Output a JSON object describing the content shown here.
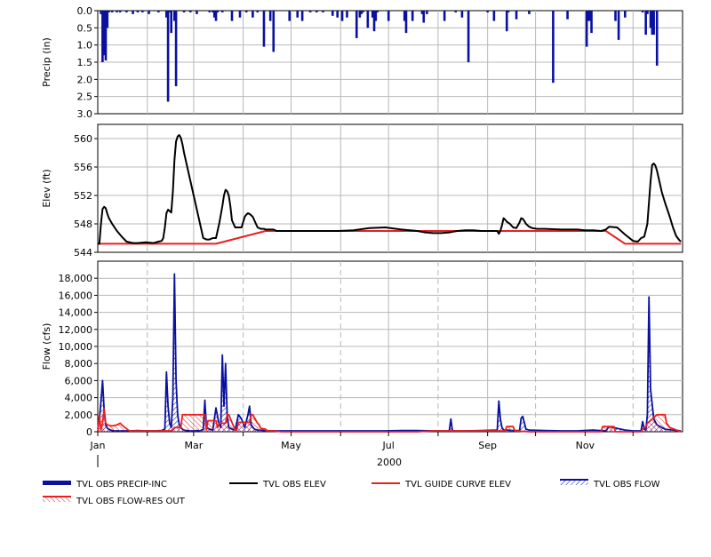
{
  "chart_data": [
    {
      "type": "bar",
      "ylabel": "Precip (in)",
      "ylim": [
        0.0,
        3.0
      ],
      "inverted": true,
      "yticks": [
        "0.0",
        "0.5",
        "1.0",
        "1.5",
        "2.0",
        "2.5",
        "3.0"
      ],
      "grid": true,
      "series": [
        {
          "name": "TVL OBS PRECIP-INC",
          "color": "#0a10a0",
          "x": [
            2,
            3,
            4,
            5,
            6,
            7,
            9,
            12,
            14,
            18,
            22,
            25,
            28,
            32,
            38,
            43,
            44,
            45,
            46,
            48,
            49,
            54,
            58,
            62,
            70,
            72,
            73,
            74,
            75,
            78,
            84,
            89,
            93,
            97,
            100,
            104,
            108,
            110,
            120,
            125,
            128,
            133,
            137,
            141,
            147,
            150,
            153,
            156,
            162,
            164,
            165,
            166,
            169,
            172,
            173,
            174,
            175,
            182,
            192,
            193,
            197,
            203,
            204,
            206,
            217,
            224,
            228,
            232,
            244,
            248,
            256,
            257,
            262,
            270,
            285,
            294,
            306,
            307,
            308,
            309,
            324,
            326,
            330,
            341,
            343,
            344,
            346,
            347,
            348,
            350
          ],
          "values": [
            0.1,
            1.5,
            1.3,
            1.45,
            0.5,
            0.05,
            0.05,
            0.05,
            0.05,
            0.05,
            0.1,
            0.05,
            0.05,
            0.1,
            0.05,
            0.2,
            2.65,
            0.05,
            0.65,
            0.3,
            2.2,
            0.05,
            0.05,
            0.1,
            0.05,
            0.05,
            0.2,
            0.3,
            0.05,
            0.05,
            0.3,
            0.2,
            0.05,
            0.2,
            0.05,
            1.05,
            0.3,
            1.2,
            0.3,
            0.2,
            0.3,
            0.05,
            0.05,
            0.05,
            0.15,
            0.2,
            0.3,
            0.2,
            0.8,
            0.2,
            0.1,
            0.05,
            0.5,
            0.2,
            0.6,
            0.3,
            0.05,
            0.3,
            0.3,
            0.65,
            0.3,
            0.1,
            0.35,
            0.1,
            0.3,
            0.05,
            0.2,
            1.5,
            0.05,
            0.3,
            0.6,
            0.05,
            0.25,
            0.1,
            2.1,
            0.25,
            1.05,
            0.3,
            0.3,
            0.65,
            0.3,
            0.85,
            0.2,
            0.05,
            0.7,
            0.1,
            0.5,
            0.7,
            0.7,
            1.6
          ]
        }
      ]
    },
    {
      "type": "line",
      "ylabel": "Elev (ft)",
      "ylim": [
        544,
        562
      ],
      "yticks": [
        "544",
        "548",
        "552",
        "556",
        "560"
      ],
      "grid": true,
      "series": [
        {
          "name": "TVL OBS ELEV",
          "color": "#000000",
          "x": [
            0,
            1,
            2,
            3,
            4,
            5,
            6,
            7,
            9,
            12,
            15,
            18,
            22,
            25,
            30,
            35,
            38,
            40,
            41,
            42,
            43,
            44,
            45,
            46,
            47,
            48,
            49,
            50,
            51,
            52,
            53,
            54,
            55,
            56,
            57,
            58,
            60,
            62,
            64,
            66,
            68,
            70,
            72,
            74,
            76,
            78,
            79,
            80,
            81,
            82,
            83,
            84,
            86,
            88,
            90,
            92,
            93,
            94,
            95,
            96,
            97,
            98,
            100,
            102,
            103,
            104,
            105,
            106,
            108,
            110,
            112,
            115,
            120,
            130,
            140,
            150,
            160,
            170,
            180,
            190,
            200,
            205,
            210,
            215,
            220,
            225,
            230,
            235,
            240,
            245,
            250,
            251,
            252,
            253,
            254,
            255,
            256,
            258,
            260,
            262,
            264,
            265,
            266,
            267,
            268,
            270,
            272,
            275,
            280,
            290,
            300,
            305,
            310,
            315,
            318,
            320,
            325,
            330,
            335,
            338,
            340,
            342,
            344,
            345,
            346,
            347,
            348,
            349,
            350,
            351,
            352,
            353,
            355,
            358,
            360,
            362,
            364,
            365
          ],
          "values": [
            545.2,
            545.2,
            548.0,
            550.1,
            550.4,
            550.2,
            549.4,
            548.8,
            548.0,
            547.0,
            546.2,
            545.5,
            545.3,
            545.3,
            545.4,
            545.3,
            545.5,
            545.6,
            546.0,
            547.5,
            549.5,
            550.0,
            549.8,
            549.6,
            552.5,
            557.0,
            559.6,
            560.3,
            560.5,
            560.1,
            559.2,
            558.0,
            557.0,
            556.0,
            555.0,
            554.0,
            552.0,
            550.0,
            548.0,
            546.0,
            545.8,
            545.8,
            546.0,
            546.0,
            548.0,
            550.5,
            552.0,
            552.8,
            552.6,
            552.0,
            550.5,
            548.5,
            547.5,
            547.5,
            547.5,
            549.0,
            549.3,
            549.5,
            549.4,
            549.2,
            549.0,
            548.5,
            547.5,
            547.3,
            547.3,
            547.3,
            547.2,
            547.2,
            547.2,
            547.2,
            547.0,
            547.0,
            547.0,
            547.0,
            547.0,
            547.0,
            547.1,
            547.4,
            547.5,
            547.2,
            547.0,
            546.8,
            546.7,
            546.7,
            546.8,
            547.0,
            547.1,
            547.1,
            547.0,
            547.0,
            547.0,
            546.6,
            547.0,
            547.8,
            548.8,
            548.6,
            548.3,
            548.0,
            547.5,
            547.4,
            548.2,
            548.8,
            548.7,
            548.4,
            548.0,
            547.6,
            547.4,
            547.3,
            547.3,
            547.2,
            547.2,
            547.1,
            547.1,
            547.0,
            547.2,
            547.6,
            547.5,
            546.5,
            545.6,
            545.5,
            546.0,
            546.2,
            548.0,
            551.0,
            554.0,
            556.3,
            556.5,
            556.2,
            555.5,
            554.5,
            553.5,
            552.5,
            551.0,
            549.0,
            547.5,
            546.3,
            545.7,
            545.5
          ]
        },
        {
          "name": "TVL GUIDE CURVE ELEV",
          "color": "#e82020",
          "x": [
            0,
            74,
            105,
            318,
            330,
            365
          ],
          "values": [
            545.2,
            545.2,
            547.0,
            547.0,
            545.2,
            545.2
          ]
        }
      ]
    },
    {
      "type": "area",
      "ylabel": "Flow (cfs)",
      "ylim": [
        0,
        20000
      ],
      "yticks": [
        "0",
        "2,000",
        "4,000",
        "6,000",
        "8,000",
        "10,000",
        "12,000",
        "14,000",
        "16,000",
        "18,000"
      ],
      "grid": true,
      "xlabel": "2000",
      "x_tick_labels": [
        "Jan",
        "Mar",
        "May",
        "Jul",
        "Sep",
        "Nov"
      ],
      "x_tick_days": [
        0,
        60,
        121,
        182,
        244,
        305
      ],
      "month_days": [
        0,
        31,
        60,
        91,
        121,
        152,
        182,
        213,
        244,
        274,
        305,
        335
      ],
      "series": [
        {
          "name": "TVL OBS FLOW",
          "color": "#0a10a0",
          "x": [
            0,
            1,
            2,
            3,
            4,
            5,
            6,
            7,
            8,
            10,
            15,
            20,
            25,
            30,
            35,
            40,
            42,
            43,
            44,
            45,
            46,
            47,
            48,
            49,
            50,
            51,
            52,
            53,
            54,
            55,
            56,
            58,
            60,
            62,
            64,
            66,
            67,
            68,
            70,
            72,
            74,
            76,
            77,
            78,
            79,
            80,
            81,
            82,
            84,
            86,
            88,
            90,
            92,
            94,
            95,
            96,
            98,
            100,
            105,
            110,
            115,
            120,
            125,
            130,
            140,
            150,
            160,
            170,
            180,
            190,
            200,
            210,
            220,
            221,
            222,
            230,
            240,
            250,
            251,
            252,
            253,
            254,
            256,
            260,
            264,
            265,
            266,
            268,
            270,
            280,
            290,
            300,
            310,
            318,
            320,
            330,
            335,
            338,
            340,
            341,
            342,
            343,
            344,
            345,
            346,
            348,
            350,
            355,
            360,
            365
          ],
          "values": [
            300,
            1500,
            3500,
            6000,
            2500,
            800,
            400,
            300,
            200,
            100,
            100,
            100,
            150,
            100,
            100,
            150,
            300,
            7000,
            3000,
            1000,
            500,
            4000,
            18500,
            6000,
            2000,
            800,
            500,
            300,
            200,
            150,
            150,
            100,
            100,
            150,
            100,
            300,
            3700,
            500,
            300,
            200,
            2800,
            800,
            500,
            9000,
            3000,
            8000,
            2000,
            500,
            300,
            200,
            2000,
            1500,
            500,
            2000,
            3000,
            800,
            300,
            200,
            150,
            100,
            100,
            100,
            100,
            100,
            100,
            100,
            100,
            100,
            100,
            150,
            150,
            100,
            100,
            1500,
            100,
            100,
            150,
            200,
            3600,
            1500,
            500,
            200,
            200,
            150,
            150,
            1600,
            1800,
            300,
            200,
            150,
            100,
            100,
            200,
            100,
            600,
            200,
            100,
            100,
            100,
            1200,
            300,
            200,
            2000,
            15800,
            5000,
            1500,
            800,
            300,
            200,
            100
          ]
        },
        {
          "name": "TVL OBS FLOW-RES OUT",
          "color": "#e82020",
          "x": [
            0,
            1,
            2,
            3,
            4,
            5,
            6,
            8,
            10,
            12,
            14,
            15,
            17,
            19,
            20,
            25,
            30,
            40,
            46,
            48,
            52,
            53,
            67,
            68,
            69,
            74,
            75,
            76,
            80,
            81,
            82,
            86,
            87,
            88,
            95,
            96,
            97,
            100,
            101,
            102,
            105,
            106,
            110,
            115,
            200,
            210,
            255,
            256,
            260,
            261,
            262,
            270,
            290,
            310,
            315,
            316,
            323,
            324,
            340,
            341,
            343,
            344,
            350,
            355,
            356,
            358,
            365
          ],
          "values": [
            0,
            2000,
            200,
            1000,
            2700,
            1000,
            800,
            700,
            700,
            800,
            1000,
            800,
            500,
            200,
            100,
            100,
            100,
            100,
            100,
            500,
            500,
            2000,
            2000,
            200,
            1300,
            1300,
            500,
            1000,
            1000,
            2000,
            2000,
            200,
            200,
            1100,
            1100,
            2000,
            2000,
            1000,
            800,
            400,
            300,
            100,
            100,
            0,
            0,
            100,
            100,
            600,
            600,
            100,
            100,
            0,
            0,
            0,
            0,
            600,
            600,
            0,
            0,
            300,
            600,
            1000,
            2000,
            2000,
            1000,
            500,
            0
          ]
        }
      ]
    }
  ]
}
